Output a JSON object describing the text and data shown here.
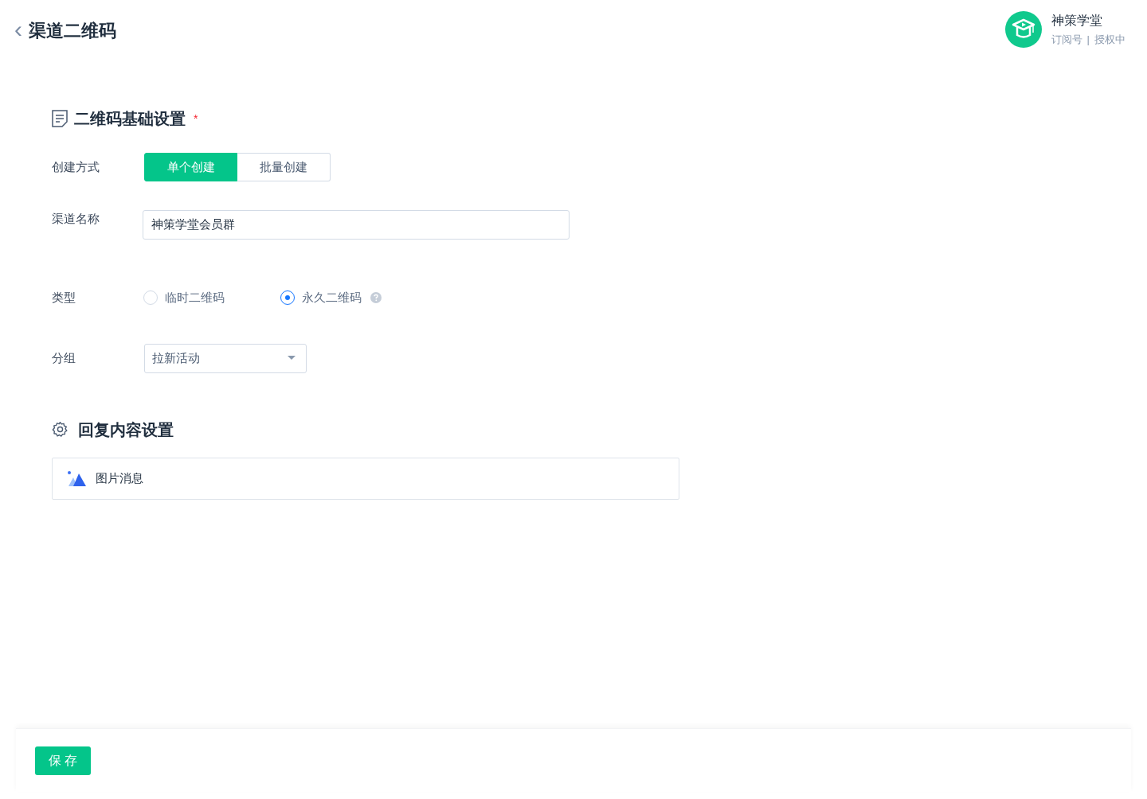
{
  "header": {
    "back": "‹",
    "title": "渠道二维码",
    "account": {
      "name": "神策学堂",
      "type": "订阅号",
      "separator": "|",
      "status": "授权中"
    }
  },
  "basic_section": {
    "title": "二维码基础设置",
    "required_mark": "*",
    "create_mode": {
      "label": "创建方式",
      "options": [
        {
          "label": "单个创建",
          "selected": true
        },
        {
          "label": "批量创建",
          "selected": false
        }
      ]
    },
    "channel_name": {
      "label": "渠道名称",
      "value": "神策学堂会员群"
    },
    "type": {
      "label": "类型",
      "options": [
        {
          "label": "临时二维码",
          "selected": false
        },
        {
          "label": "永久二维码",
          "selected": true,
          "help": true
        }
      ]
    },
    "group": {
      "label": "分组",
      "value": "拉新活动"
    }
  },
  "reply_section": {
    "title": "回复内容设置",
    "item": "图片消息"
  },
  "footer": {
    "save": "保 存"
  }
}
